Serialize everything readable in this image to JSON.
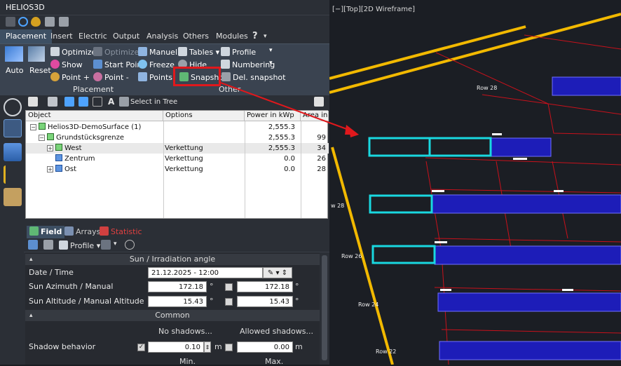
{
  "app": {
    "title": "HELIOS3D"
  },
  "tabs": [
    "Placement",
    "Insert",
    "Electric",
    "Output",
    "Analysis",
    "Others",
    "Modules",
    "?"
  ],
  "ribbon": {
    "auto": "Auto",
    "reset": "Reset",
    "optimize": "Optimize",
    "optimized": "Optimized",
    "manuel": "Manuel",
    "show": "Show",
    "start_point": "Start Point",
    "freeze": "Freeze",
    "point_plus": "Point +",
    "point_minus": "Point -",
    "points": "Points",
    "placement_group": "Placement",
    "tables": "Tables",
    "profile": "Profile",
    "hide": "Hide",
    "numbering": "Numbering",
    "snapshot": "Snapshot",
    "del_snapshot": "Del. snapshot",
    "other_group": "Other"
  },
  "tree_toolbar": {
    "select_in_tree": "Select in Tree"
  },
  "grid": {
    "headers": [
      "Object",
      "Options",
      "Power in kWp",
      "Area in"
    ],
    "rows": [
      {
        "name": "Helios3D-DemoSurface (1)",
        "option": "",
        "power": "2,555.3",
        "area": ""
      },
      {
        "name": "Grundstücksgrenze",
        "option": "",
        "power": "2,555.3",
        "area": "99"
      },
      {
        "name": "West",
        "option": "Verkettung",
        "power": "2,555.3",
        "area": "34"
      },
      {
        "name": "Zentrum",
        "option": "Verkettung",
        "power": "0.0",
        "area": "26"
      },
      {
        "name": "Ost",
        "option": "Verkettung",
        "power": "0.0",
        "area": "28"
      }
    ]
  },
  "panel_tabs": [
    "Field",
    "Arrays",
    "Statistic"
  ],
  "panel_toolbar": {
    "profile": "Profile"
  },
  "props": {
    "sun_section": "Sun / Irradiation angle",
    "date_label": "Date / Time",
    "date_value": "21.12.2025 - 12:00",
    "azimuth_label": "Sun Azimuth / Manual",
    "azimuth_value": "172.18",
    "azimuth_manual": "172.18",
    "altitude_label": "Sun Altitude / Manual Altitude",
    "altitude_value": "15.43",
    "altitude_manual": "15.43",
    "deg": "°",
    "common_section": "Common",
    "no_shadows": "No shadows...",
    "allowed_shadows": "Allowed shadows...",
    "shadow_label": "Shadow behavior",
    "shadow_min": "0.10",
    "shadow_max": "0.00",
    "unit_m": "m",
    "min": "Min.",
    "max": "Max."
  },
  "viewport": {
    "title": "[−][Top][2D Wireframe]",
    "row_labels": [
      "Row 28",
      "Row 26",
      "Row 24",
      "Row 22",
      "w 28"
    ]
  },
  "colors": {
    "accent": "#3d4f63",
    "highlight": "#e0181c",
    "cyan": "#19d8e0",
    "road": "#f2b900",
    "panel": "#1d1db8"
  }
}
